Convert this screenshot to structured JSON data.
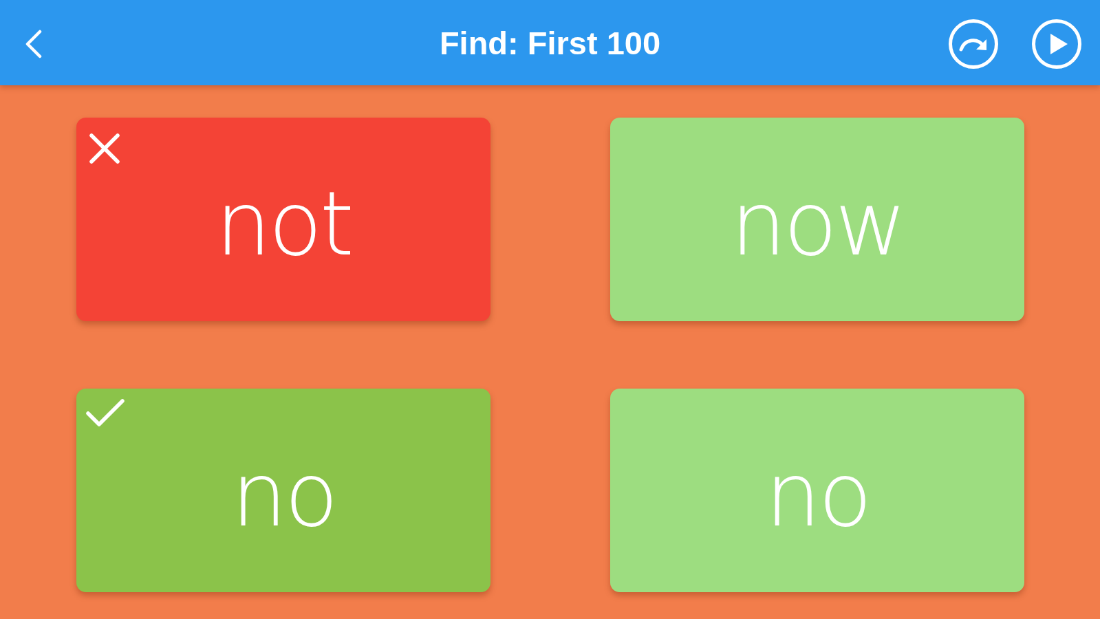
{
  "header": {
    "title": "Find: First 100"
  },
  "cards": [
    {
      "word": "not",
      "kind": "wrong"
    },
    {
      "word": "now",
      "kind": "plain"
    },
    {
      "word": "no",
      "kind": "correct"
    },
    {
      "word": "no",
      "kind": "plain"
    }
  ]
}
